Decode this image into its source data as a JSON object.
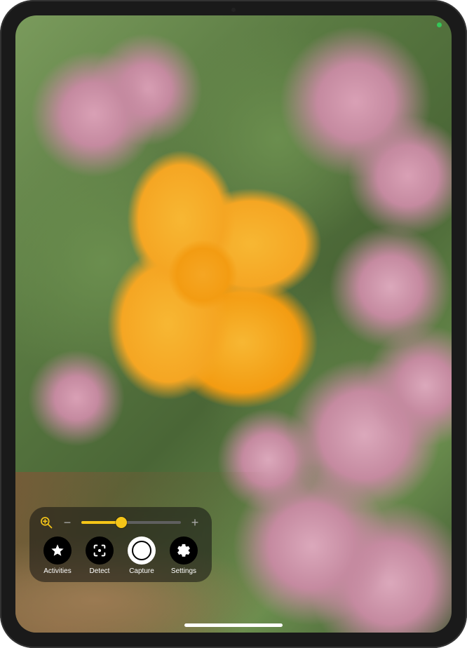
{
  "status": {
    "camera_active_color": "#34c759"
  },
  "zoom": {
    "min_icon": "magnifier-plus",
    "minus_glyph": "−",
    "plus_glyph": "+",
    "percent": 40
  },
  "controls": [
    {
      "id": "activities",
      "label": "Activities",
      "icon": "star-filled"
    },
    {
      "id": "detect",
      "label": "Detect",
      "icon": "viewfinder"
    },
    {
      "id": "capture",
      "label": "Capture",
      "icon": "shutter"
    },
    {
      "id": "settings",
      "label": "Settings",
      "icon": "gear"
    }
  ],
  "colors": {
    "accent": "#f5c518"
  }
}
